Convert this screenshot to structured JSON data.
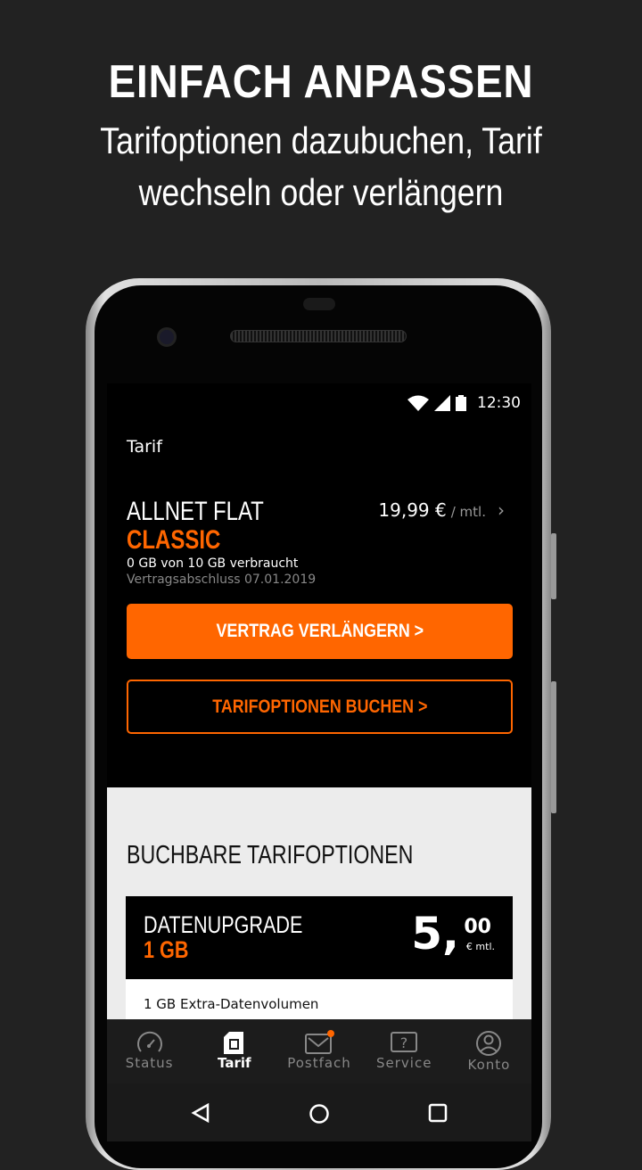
{
  "promo": {
    "title": "EINFACH ANPASSEN",
    "subtitle_line1": "Tarifoptionen dazubuchen, Tarif",
    "subtitle_line2": "wechseln oder verlängern"
  },
  "status_bar": {
    "time": "12:30",
    "icons": [
      "wifi-icon",
      "signal-icon",
      "battery-icon"
    ]
  },
  "header": {
    "title": "Tarif"
  },
  "plan": {
    "name": "ALLNET FLAT",
    "tier": "CLASSIC",
    "price": "19,99 €",
    "price_unit": "/ mtl.",
    "usage": "0 GB von 10 GB verbraucht",
    "contract": "Vertragsabschluss 07.01.2019"
  },
  "buttons": {
    "renew": "VERTRAG VERLÄNGERN >",
    "options": "TARIFOPTIONEN BUCHEN >"
  },
  "options": {
    "heading": "BUCHBARE TARIFOPTIONEN",
    "items": [
      {
        "name": "DATENUPGRADE",
        "size": "1 GB",
        "price_int": "5,",
        "price_dec": "00",
        "price_unit": "€ mtl.",
        "description": "1 GB Extra-Datenvolumen"
      }
    ]
  },
  "nav": {
    "items": [
      {
        "label": "Status",
        "icon": "speedometer-icon"
      },
      {
        "label": "Tarif",
        "icon": "sim-card-icon",
        "active": true
      },
      {
        "label": "Postfach",
        "icon": "mail-icon",
        "badge": true
      },
      {
        "label": "Service",
        "icon": "help-icon"
      },
      {
        "label": "Konto",
        "icon": "user-icon"
      }
    ]
  },
  "colors": {
    "accent": "#ff6600",
    "background": "#222222"
  }
}
